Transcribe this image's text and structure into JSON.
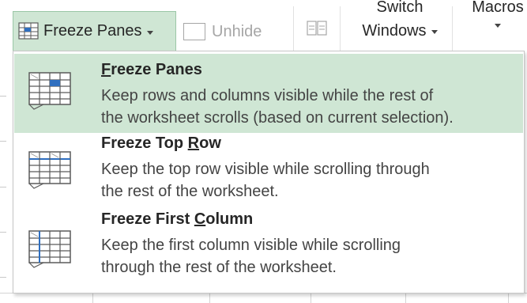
{
  "ribbon": {
    "freeze_panes_label": "Freeze Panes",
    "unhide_label": "Unhide",
    "switch_windows_line1": "Switch",
    "switch_windows_line2": "Windows",
    "macros_label": "Macros"
  },
  "menu": {
    "items": [
      {
        "title_first": "F",
        "title_rest": "reeze Panes",
        "desc_line1": "Keep rows and columns visible while the rest of",
        "desc_line2": "the worksheet scrolls (based on current selection).",
        "icon": "freeze-panes-icon",
        "selected": true
      },
      {
        "title_before": "Freeze Top ",
        "title_key": "R",
        "title_after": "ow",
        "desc_line1": "Keep the top row visible while scrolling through",
        "desc_line2": "the rest of the worksheet.",
        "icon": "freeze-top-row-icon",
        "selected": false
      },
      {
        "title_before": "Freeze First ",
        "title_key": "C",
        "title_after": "olumn",
        "desc_line1": "Keep the first column visible while scrolling",
        "desc_line2": "through the rest of the worksheet.",
        "icon": "freeze-first-column-icon",
        "selected": false
      }
    ]
  },
  "colors": {
    "selected_bg": "#cfe6d4",
    "selected_border": "#9bc7a6",
    "icon_blue": "#2f6fbf",
    "disabled_text": "#a6a6a6"
  }
}
